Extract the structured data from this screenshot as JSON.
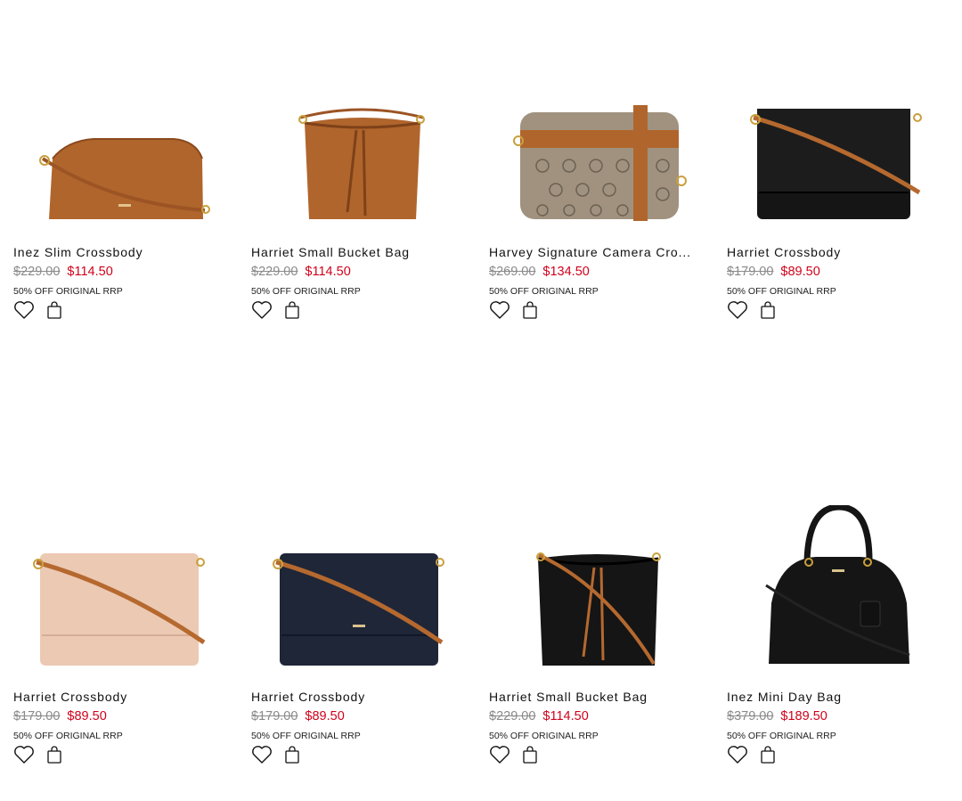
{
  "products": [
    {
      "name": "Inez Slim Crossbody",
      "old_price": "$229.00",
      "new_price": "$114.50",
      "note": "50% OFF ORIGINAL RRP",
      "image": "tan-crossbody-bag"
    },
    {
      "name": "Harriet Small Bucket Bag",
      "old_price": "$229.00",
      "new_price": "$114.50",
      "note": "50% OFF ORIGINAL RRP",
      "image": "tan-bucket-bag"
    },
    {
      "name": "Harvey Signature Camera Cro...",
      "old_price": "$269.00",
      "new_price": "$134.50",
      "note": "50% OFF ORIGINAL RRP",
      "image": "monogram-camera-bag"
    },
    {
      "name": "Harriet Crossbody",
      "old_price": "$179.00",
      "new_price": "$89.50",
      "note": "50% OFF ORIGINAL RRP",
      "image": "black-crossbody-bag"
    },
    {
      "name": "Harriet Crossbody",
      "old_price": "$179.00",
      "new_price": "$89.50",
      "note": "50% OFF ORIGINAL RRP",
      "image": "blush-crossbody-bag"
    },
    {
      "name": "Harriet Crossbody",
      "old_price": "$179.00",
      "new_price": "$89.50",
      "note": "50% OFF ORIGINAL RRP",
      "image": "navy-crossbody-bag"
    },
    {
      "name": "Harriet Small Bucket Bag",
      "old_price": "$229.00",
      "new_price": "$114.50",
      "note": "50% OFF ORIGINAL RRP",
      "image": "black-bucket-bag"
    },
    {
      "name": "Inez Mini Day Bag",
      "old_price": "$379.00",
      "new_price": "$189.50",
      "note": "50% OFF ORIGINAL RRP",
      "image": "black-day-bag"
    }
  ],
  "colors": {
    "sale_price": "#d0021b",
    "old_price": "#8a8a8a",
    "tan": "#b0652c",
    "black": "#151515",
    "navy": "#1f2638",
    "blush": "#ecc9b3",
    "strap": "#b5692f"
  },
  "icons": {
    "wishlist": "heart-icon",
    "cart": "shopping-bag-icon"
  }
}
